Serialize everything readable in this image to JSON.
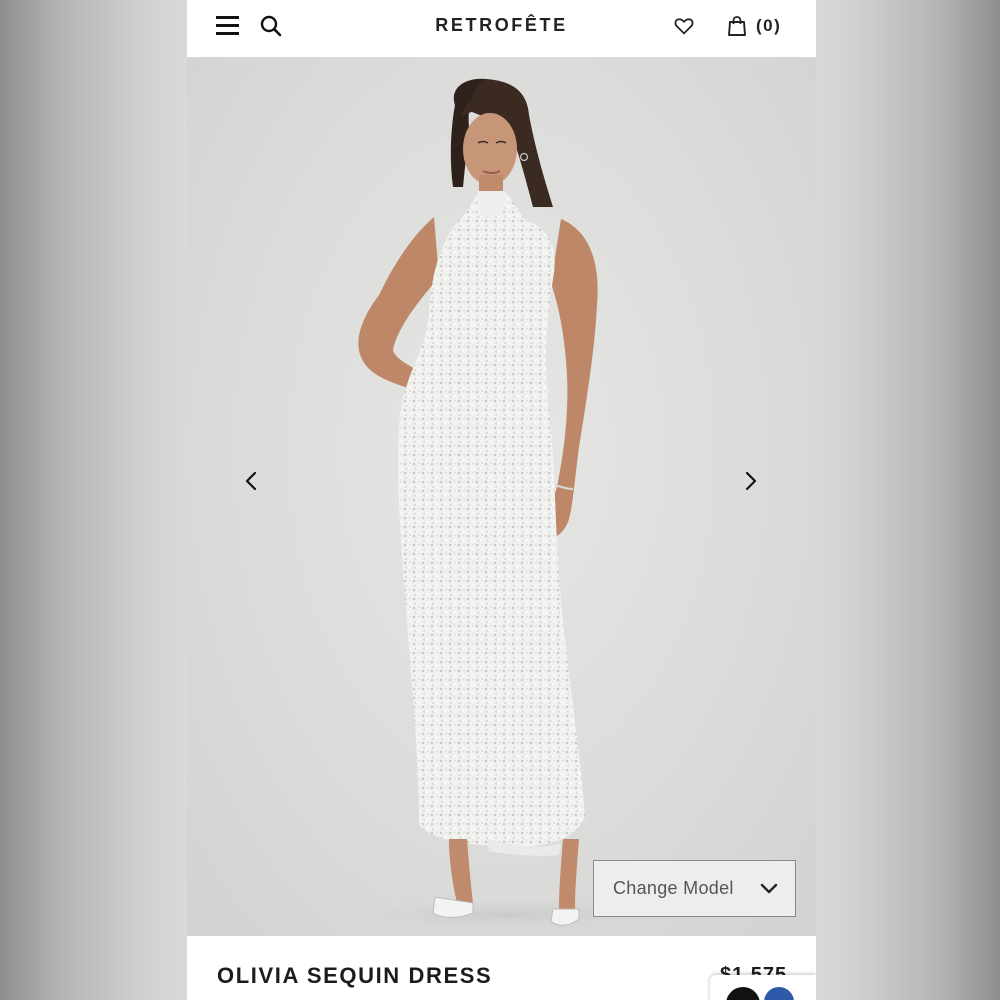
{
  "header": {
    "brand": "RETROFÊTE",
    "cart_count": "(0)",
    "icons": [
      "menu-icon",
      "search-icon",
      "heart-icon",
      "bag-icon"
    ]
  },
  "gallery": {
    "prev_icon": "chevron-left-icon",
    "next_icon": "chevron-right-icon",
    "change_model_label": "Change Model"
  },
  "product": {
    "name": "OLIVIA SEQUIN DRESS",
    "price": "$1,575"
  },
  "colors": {
    "text": "#1c1c1c",
    "background": "#ffffff",
    "hero_bg": "#dcdcda"
  }
}
